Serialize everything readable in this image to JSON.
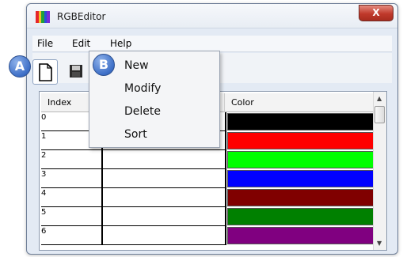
{
  "window": {
    "title": "RGBEditor",
    "close_label": "X",
    "app_icon_colors": [
      "#e6262a",
      "#f2c22a",
      "#1fa23a",
      "#2a4fd8",
      "#7a2ad6"
    ]
  },
  "menubar": {
    "file": "File",
    "edit": "Edit",
    "help": "Help"
  },
  "callouts": {
    "a": "A",
    "b": "B"
  },
  "file_menu": {
    "items": [
      "New",
      "Modify",
      "Delete",
      "Sort"
    ]
  },
  "table": {
    "columns": [
      "Index",
      "",
      "Color"
    ],
    "rows": [
      {
        "index": "0",
        "color": "#000000"
      },
      {
        "index": "1",
        "color": "#ff0000"
      },
      {
        "index": "2",
        "color": "#00ff00"
      },
      {
        "index": "3",
        "color": "#0000ff"
      },
      {
        "index": "4",
        "color": "#800000"
      },
      {
        "index": "5",
        "color": "#008000"
      },
      {
        "index": "6",
        "color": "#800080"
      }
    ]
  },
  "icons": {
    "new": "new-document-icon",
    "save": "save-icon",
    "scroll_up": "chevron-up-icon",
    "scroll_down": "chevron-down-icon"
  }
}
